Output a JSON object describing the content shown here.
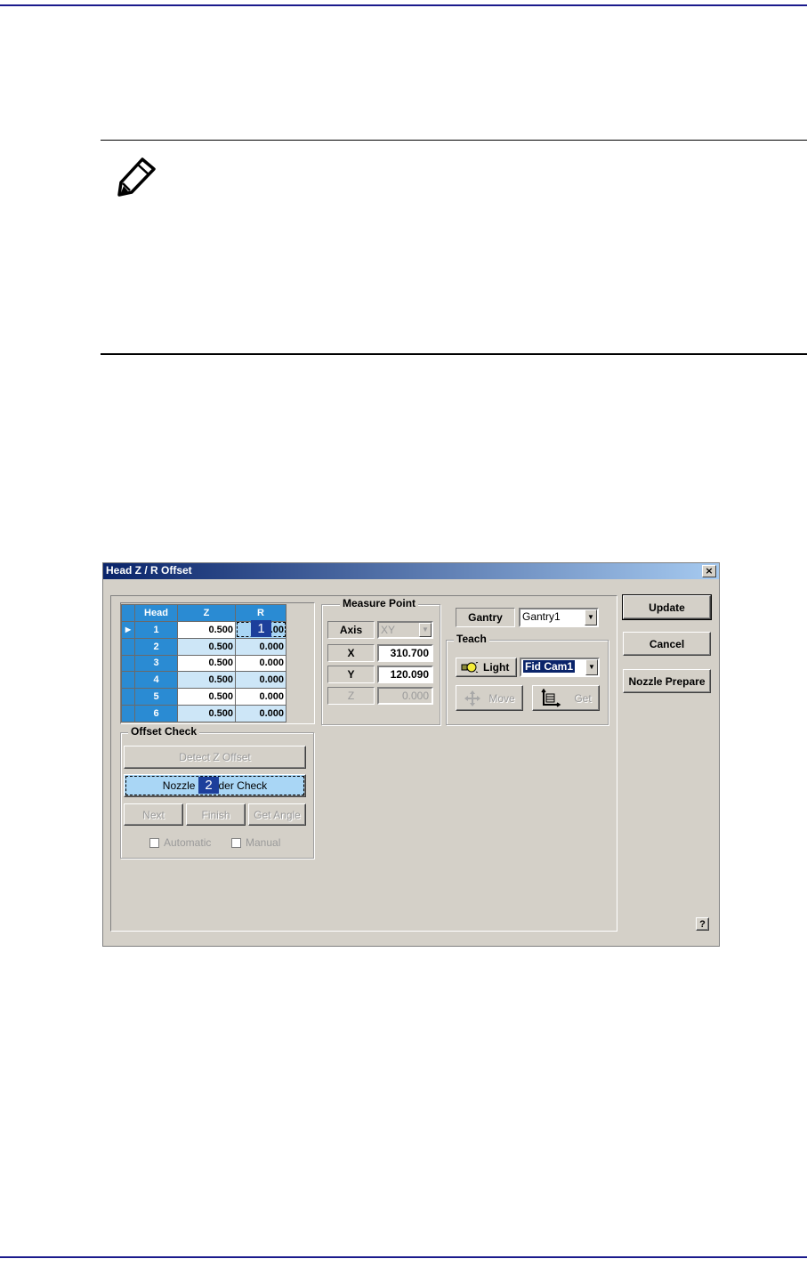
{
  "dialog": {
    "title": "Head Z / R Offset",
    "close_label": "×",
    "grid": {
      "headers": [
        "Head",
        "Z",
        "R"
      ],
      "rows": [
        {
          "head": "1",
          "z": "0.500",
          "r": ".00"
        },
        {
          "head": "2",
          "z": "0.500",
          "r": "0.000"
        },
        {
          "head": "3",
          "z": "0.500",
          "r": "0.000"
        },
        {
          "head": "4",
          "z": "0.500",
          "r": "0.000"
        },
        {
          "head": "5",
          "z": "0.500",
          "r": "0.000"
        },
        {
          "head": "6",
          "z": "0.500",
          "r": "0.000"
        }
      ],
      "row_marker": "▶"
    },
    "measure_point": {
      "title": "Measure Point",
      "axis_label": "Axis",
      "axis_value": "XY",
      "x_label": "X",
      "x_value": "310.700",
      "y_label": "Y",
      "y_value": "120.090",
      "z_label": "Z",
      "z_value": "0.000"
    },
    "gantry": {
      "label": "Gantry",
      "value": "Gantry1"
    },
    "teach": {
      "title": "Teach",
      "light_label": "Light",
      "camera_value": "Fid Cam1",
      "move_label": "Move",
      "get_label": "Get"
    },
    "offset_check": {
      "title": "Offset Check",
      "detect_z_label": "Detect Z Offset",
      "nozzle_holder_label_left": "Nozzle",
      "nozzle_holder_label_right": "der Check",
      "next_label": "Next",
      "finish_label": "Finish",
      "get_angle_label": "Get Angle",
      "automatic_label": "Automatic",
      "manual_label": "Manual"
    },
    "side_buttons": {
      "update": "Update",
      "cancel": "Cancel",
      "nozzle_prepare": "Nozzle Prepare"
    },
    "help_label": "?",
    "callouts": [
      "1",
      "2"
    ]
  }
}
